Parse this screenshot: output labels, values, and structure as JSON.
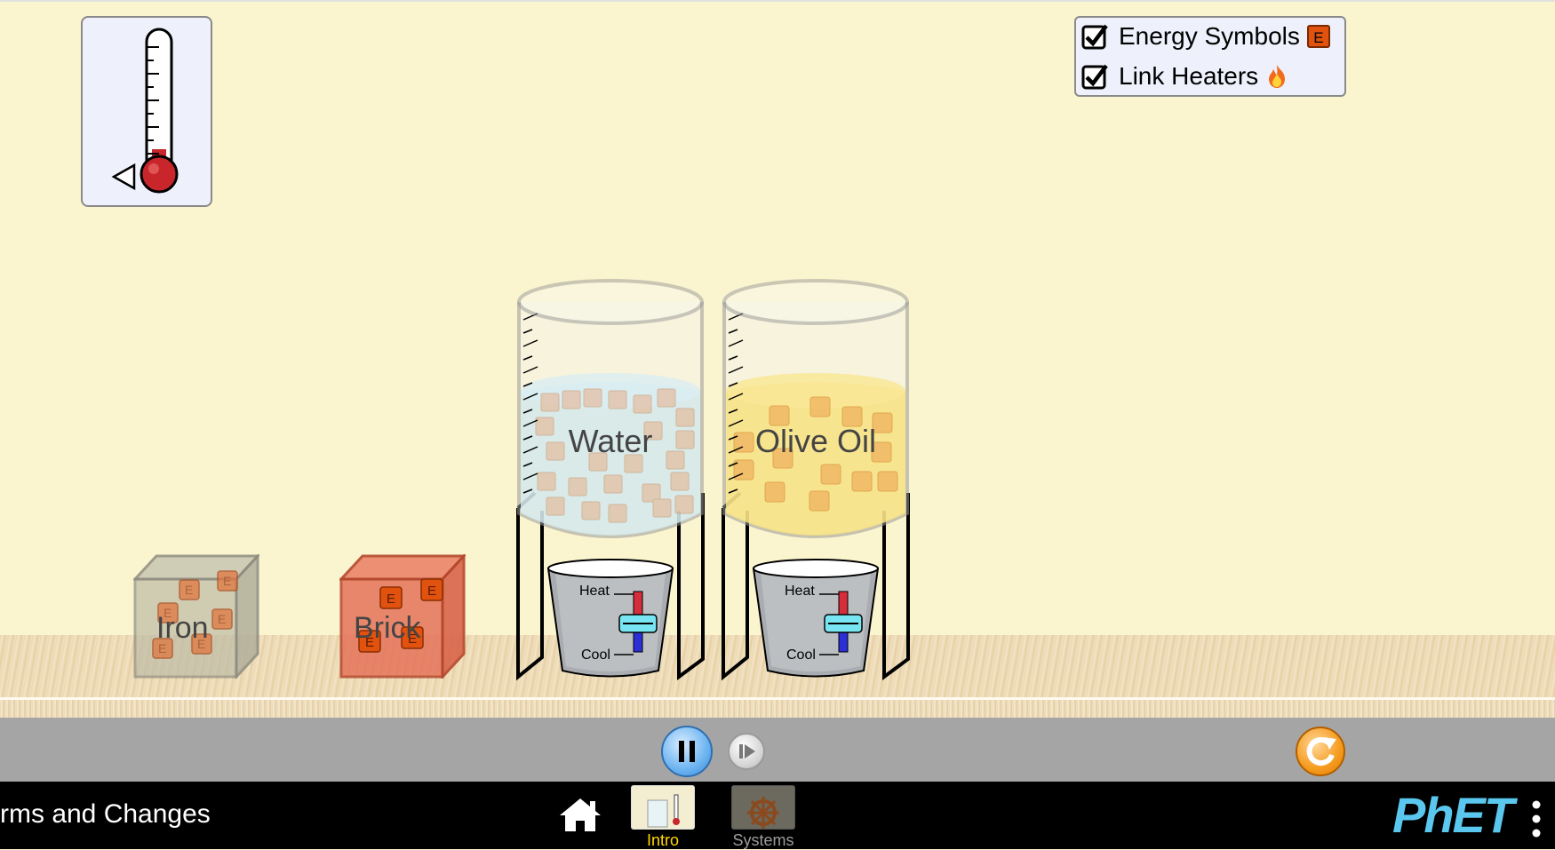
{
  "checkboxes": {
    "energy_symbols": {
      "label": "Energy Symbols",
      "checked": true,
      "chip": "E"
    },
    "link_heaters": {
      "label": "Link Heaters",
      "checked": true,
      "icon": "flame-icon"
    }
  },
  "blocks": {
    "iron": {
      "label": "Iron",
      "color": "#b9b7a4"
    },
    "brick": {
      "label": "Brick",
      "color": "#e2674a"
    }
  },
  "beakers": {
    "water": {
      "label": "Water",
      "color": "#cfe7ee"
    },
    "olive_oil": {
      "label": "Olive Oil",
      "color": "#f6e07c"
    }
  },
  "heaters": {
    "heat_label": "Heat",
    "cool_label": "Cool"
  },
  "energy_chunk_text": "E",
  "nav": {
    "sim_title": "rms and Changes",
    "tabs": [
      {
        "label": "Intro",
        "selected": true
      },
      {
        "label": "Systems",
        "selected": false
      }
    ],
    "logo": "PhET"
  },
  "colors": {
    "background": "#fbf5cf",
    "selected_tab": "#ffd700",
    "unselected_tab": "#9c9c9c",
    "energy_chunk": "#e0520d"
  }
}
